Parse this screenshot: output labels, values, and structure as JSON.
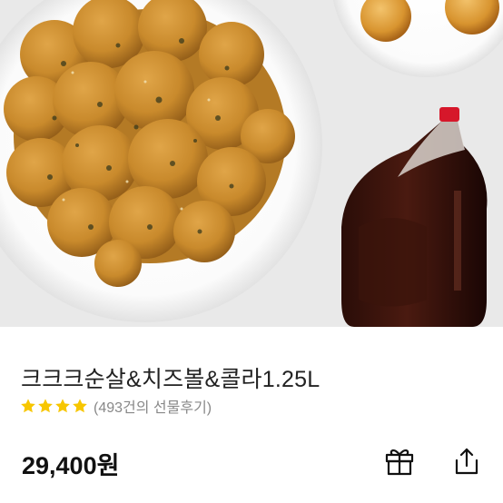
{
  "product": {
    "name": "크크크순살&치즈볼&콜라1.25L",
    "rating_stars": 4,
    "review_text": "(493건의 선물후기)",
    "price": "29,400원"
  },
  "icons": {
    "gift": "gift-icon",
    "share": "share-icon",
    "star": "star-icon"
  },
  "colors": {
    "star": "#f7c600",
    "price": "#111111"
  }
}
